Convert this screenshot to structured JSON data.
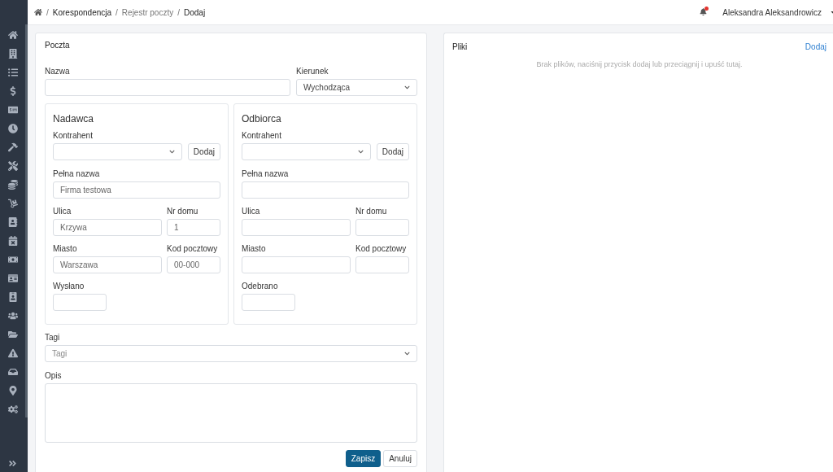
{
  "breadcrumb_separator": "/",
  "breadcrumb": [
    {
      "label": "Korespondencja",
      "kind": "link"
    },
    {
      "label": "Rejestr poczty",
      "kind": "muted"
    },
    {
      "label": "Dodaj",
      "kind": "current"
    }
  ],
  "user": {
    "name": "Aleksandra Aleksandrowicz",
    "notification": true
  },
  "form": {
    "title": "Poczta",
    "name": {
      "label": "Nazwa"
    },
    "direction": {
      "label": "Kierunek",
      "value": "Wychodząca"
    },
    "parties": [
      {
        "title": "Nadawca",
        "contractor_label": "Kontrahent",
        "add_button": "Dodaj",
        "rows": [
          {
            "kind": "full",
            "fields": [
              {
                "label": "Pełna nazwa",
                "value": "Firma testowa"
              }
            ]
          },
          {
            "kind": "pair",
            "fields": [
              {
                "label": "Ulica",
                "value": "Krzywa"
              },
              {
                "label": "Nr domu",
                "value": "1"
              }
            ]
          },
          {
            "kind": "pair",
            "fields": [
              {
                "label": "Miasto",
                "value": "Warszawa"
              },
              {
                "label": "Kod pocztowy",
                "value": "00-000"
              }
            ]
          },
          {
            "kind": "date",
            "fields": [
              {
                "label": "Wysłano"
              }
            ]
          }
        ]
      },
      {
        "title": "Odbiorca",
        "contractor_label": "Kontrahent",
        "add_button": "Dodaj",
        "rows": [
          {
            "kind": "full",
            "fields": [
              {
                "label": "Pełna nazwa"
              }
            ]
          },
          {
            "kind": "pair",
            "fields": [
              {
                "label": "Ulica"
              },
              {
                "label": "Nr domu"
              }
            ]
          },
          {
            "kind": "pair",
            "fields": [
              {
                "label": "Miasto"
              },
              {
                "label": "Kod pocztowy"
              }
            ]
          },
          {
            "kind": "date",
            "fields": [
              {
                "label": "Odebrano"
              }
            ]
          }
        ]
      }
    ],
    "tags": {
      "label": "Tagi",
      "placeholder": "Tagi"
    },
    "description": {
      "label": "Opis"
    },
    "buttons": [
      {
        "label": "Zapisz",
        "kind": "primary"
      },
      {
        "label": "Anuluj",
        "kind": "secondary"
      }
    ]
  },
  "files": {
    "title": "Pliki",
    "add_link": "Dodaj",
    "empty_message": "Brak plików, naciśnij przycisk dodaj lub przeciągnij i upuść tutaj."
  }
}
